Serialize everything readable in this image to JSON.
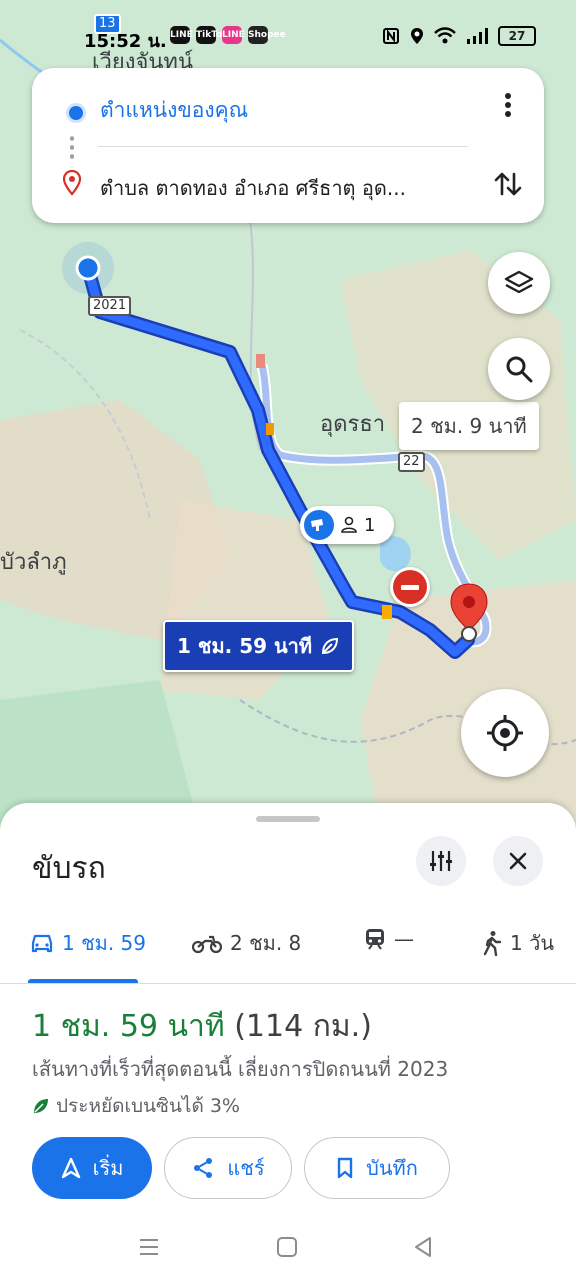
{
  "status_bar": {
    "time": "15:52 น.",
    "battery": "27",
    "apps": [
      "LINE",
      "TikTok",
      "LINE",
      "Shopee"
    ]
  },
  "search": {
    "origin": "ตำแหน่งของคุณ",
    "destination": "ตำบล ตาดทอง อำเภอ ศรีธาตุ อุด..."
  },
  "map": {
    "labels": {
      "top_town": "เวียงจันทน์",
      "udon": "อุดรธา",
      "left_town": "บัวลำภู"
    },
    "shields": [
      "13",
      "2021",
      "22"
    ],
    "route_main_time": "1 ชม. 59 นาที",
    "route_alt_time": "2 ชม. 9 นาที",
    "camera_count": "1"
  },
  "sheet": {
    "title": "ขับรถ",
    "modes": [
      {
        "name": "car",
        "label": "1 ชม. 59"
      },
      {
        "name": "motorbike",
        "label": "2 ชม. 8"
      },
      {
        "name": "transit",
        "label": "—"
      },
      {
        "name": "walk",
        "label": "1 วัน"
      }
    ],
    "result": {
      "time": "1 ชม. 59 นาที",
      "distance": "(114 กม.)",
      "description": "เส้นทางที่เร็วที่สุดตอนนี้ เลี่ยงการปิดถนนที่ 2023",
      "eco": "ประหยัดเบนซินได้ 3%"
    },
    "buttons": {
      "start": "เริ่ม",
      "share": "แชร์",
      "save": "บันทึก"
    }
  },
  "colors": {
    "primary": "#1a73e8",
    "route_main": "#1a3fb4",
    "route_alt": "#a8c0f0",
    "time_green": "#188038",
    "closure_red": "#d93025"
  }
}
